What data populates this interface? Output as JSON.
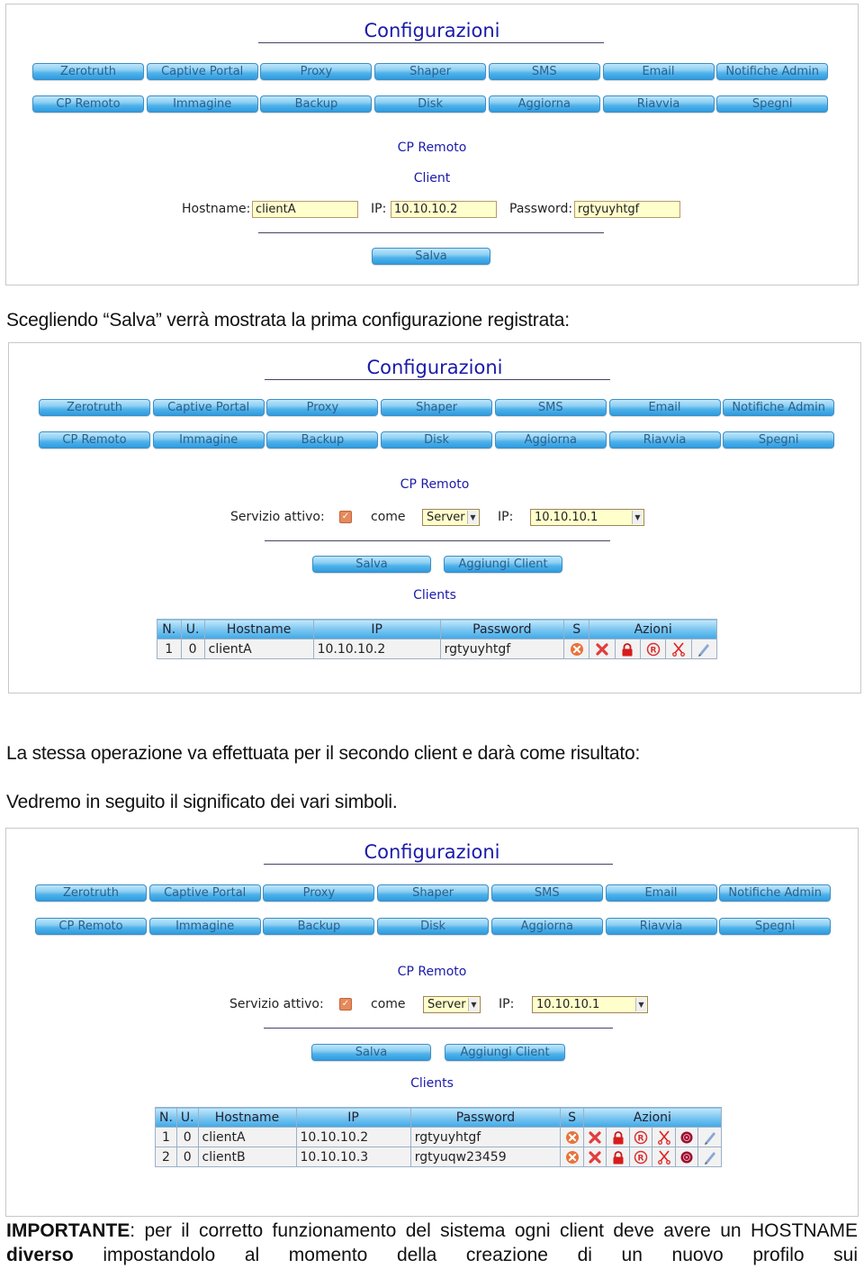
{
  "panels": [
    {
      "title": "Configurazioni",
      "menu_row1": [
        "Zerotruth",
        "Captive Portal",
        "Proxy",
        "Shaper",
        "SMS",
        "Email",
        "Notifiche Admin"
      ],
      "menu_row2": [
        "CP Remoto",
        "Immagine",
        "Backup",
        "Disk",
        "Aggiorna",
        "Riavvia",
        "Spegni"
      ],
      "section": "CP Remoto",
      "subsection": "Client",
      "hostname_label": "Hostname:",
      "hostname_value": "clientA",
      "ip_label": "IP:",
      "ip_value": "10.10.10.2",
      "password_label": "Password:",
      "password_value": "rgtyuyhtgf",
      "save_label": "Salva"
    },
    {
      "title": "Configurazioni",
      "menu_row1": [
        "Zerotruth",
        "Captive Portal",
        "Proxy",
        "Shaper",
        "SMS",
        "Email",
        "Notifiche Admin"
      ],
      "menu_row2": [
        "CP Remoto",
        "Immagine",
        "Backup",
        "Disk",
        "Aggiorna",
        "Riavvia",
        "Spegni"
      ],
      "section": "CP Remoto",
      "service_label": "Servizio attivo:",
      "service_checked": true,
      "as_label": "come",
      "mode_value": "Server",
      "ip_label": "IP:",
      "ip_value": "10.10.10.1",
      "save_label": "Salva",
      "add_client_label": "Aggiungi Client",
      "clients_title": "Clients",
      "table_headers": [
        "N.",
        "U.",
        "Hostname",
        "IP",
        "Password",
        "S",
        "Azioni"
      ],
      "rows": [
        {
          "n": "1",
          "u": "0",
          "hostname": "clientA",
          "ip": "10.10.10.2",
          "password": "rgtyuyhtgf"
        }
      ],
      "actions": [
        "delete",
        "lock",
        "register",
        "cut",
        "edit"
      ]
    },
    {
      "title": "Configurazioni",
      "menu_row1": [
        "Zerotruth",
        "Captive Portal",
        "Proxy",
        "Shaper",
        "SMS",
        "Email",
        "Notifiche Admin"
      ],
      "menu_row2": [
        "CP Remoto",
        "Immagine",
        "Backup",
        "Disk",
        "Aggiorna",
        "Riavvia",
        "Spegni"
      ],
      "section": "CP Remoto",
      "service_label": "Servizio attivo:",
      "service_checked": true,
      "as_label": "come",
      "mode_value": "Server",
      "ip_label": "IP:",
      "ip_value": "10.10.10.1",
      "save_label": "Salva",
      "add_client_label": "Aggiungi Client",
      "clients_title": "Clients",
      "table_headers": [
        "N.",
        "U.",
        "Hostname",
        "IP",
        "Password",
        "S",
        "Azioni"
      ],
      "rows": [
        {
          "n": "1",
          "u": "0",
          "hostname": "clientA",
          "ip": "10.10.10.2",
          "password": "rgtyuyhtgf"
        },
        {
          "n": "2",
          "u": "0",
          "hostname": "clientB",
          "ip": "10.10.10.3",
          "password": "rgtyuqw23459"
        }
      ],
      "actions": [
        "delete",
        "lock",
        "register",
        "cut",
        "target",
        "edit"
      ]
    }
  ],
  "text": {
    "p1": "Scegliendo “Salva” verrà mostrata la prima configurazione registrata:",
    "p2": "La stessa operazione va effettuata per il secondo client e darà come risultato:",
    "p3": "Vedremo in seguito il significato dei vari simboli.",
    "important_bold": "IMPORTANTE",
    "important_a": ": per il corretto funzionamento del sistema ogni client deve avere un HOSTNAME ",
    "important_bold2": "diverso",
    "important_b": " impostandolo al momento della creazione di un nuovo profilo sui"
  },
  "colors": {
    "title": "#1a1aaa",
    "input_bg": "#ffffcc",
    "button_top": "#bfe6fb",
    "button_bottom": "#2f9be0"
  }
}
